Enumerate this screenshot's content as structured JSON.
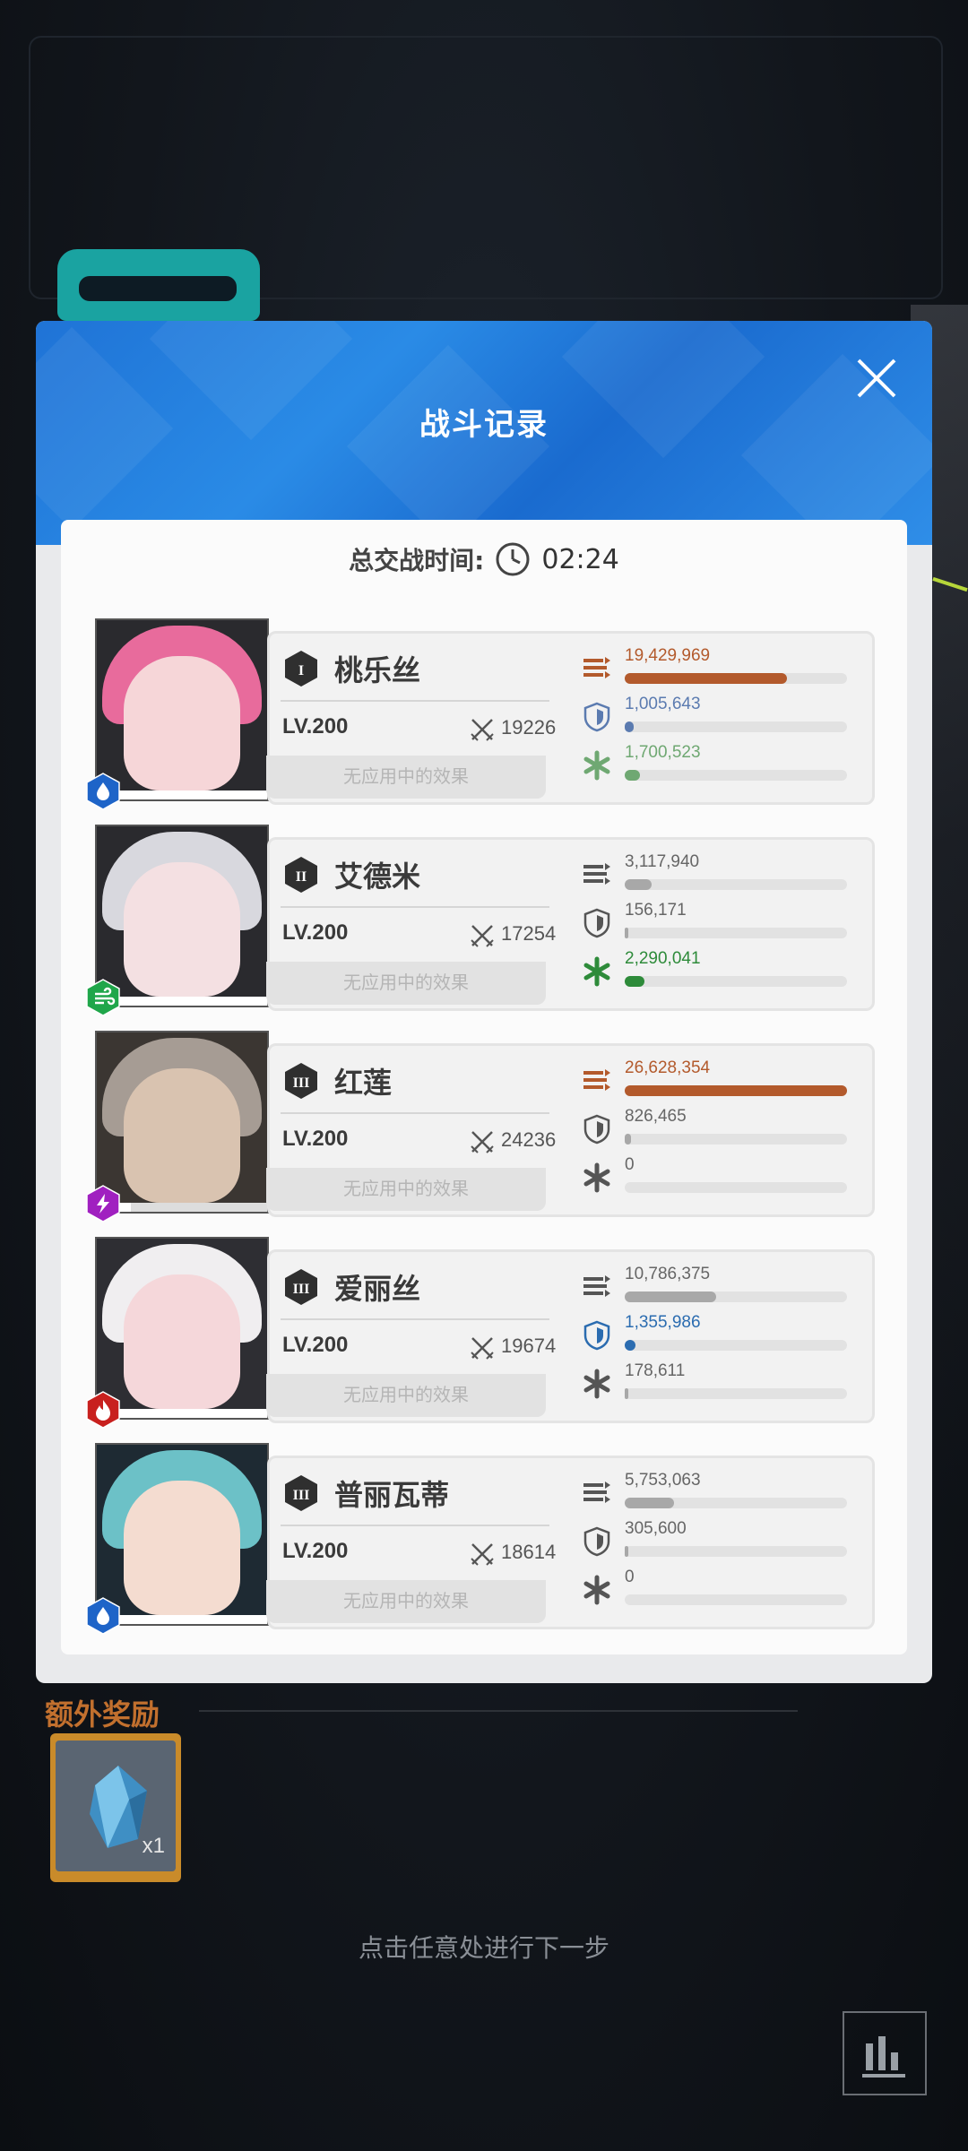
{
  "header": {
    "title": "战斗记录",
    "close_icon": "close-icon"
  },
  "battle": {
    "total_time_label": "总交战时间:",
    "total_time_value": "02:24"
  },
  "colors": {
    "panel_blue": "#1f73d6",
    "damage_bar": "#b35a2c",
    "defense_bar": "#2b6cb0",
    "heal_bar": "#2e8b3a",
    "grey_bar": "#a8a8a8",
    "bonus_title": "#c2702e"
  },
  "characters": [
    {
      "rank": "I",
      "name": "桃乐丝",
      "level": "LV.200",
      "power": "19226",
      "effect": "无应用中的效果",
      "element": "water",
      "damage": "19,429,969",
      "damage_ratio": 0.73,
      "damage_color": "#b35a2c",
      "defense": "1,005,643",
      "defense_ratio": 0.04,
      "defense_color": "#5b7bb0",
      "heal": "1,700,523",
      "heal_ratio": 0.07,
      "heal_color": "#6fa872"
    },
    {
      "rank": "II",
      "name": "艾德米",
      "level": "LV.200",
      "power": "17254",
      "effect": "无应用中的效果",
      "element": "wind",
      "damage": "3,117,940",
      "damage_ratio": 0.12,
      "damage_color": "#a8a8a8",
      "defense": "156,171",
      "defense_ratio": 0.01,
      "defense_color": "#a8a8a8",
      "heal": "2,290,041",
      "heal_ratio": 0.09,
      "heal_color": "#2e8b3a"
    },
    {
      "rank": "III",
      "name": "红莲",
      "level": "LV.200",
      "power": "24236",
      "effect": "无应用中的效果",
      "element": "electric",
      "damage": "26,628,354",
      "damage_ratio": 1.0,
      "damage_color": "#b35a2c",
      "defense": "826,465",
      "defense_ratio": 0.03,
      "defense_color": "#a8a8a8",
      "heal": "0",
      "heal_ratio": 0.0,
      "heal_color": "#a8a8a8"
    },
    {
      "rank": "III",
      "name": "爱丽丝",
      "level": "LV.200",
      "power": "19674",
      "effect": "无应用中的效果",
      "element": "fire",
      "damage": "10,786,375",
      "damage_ratio": 0.41,
      "damage_color": "#a8a8a8",
      "defense": "1,355,986",
      "defense_ratio": 0.05,
      "defense_color": "#2b6cb0",
      "heal": "178,611",
      "heal_ratio": 0.01,
      "heal_color": "#a8a8a8"
    },
    {
      "rank": "III",
      "name": "普丽瓦蒂",
      "level": "LV.200",
      "power": "18614",
      "effect": "无应用中的效果",
      "element": "water",
      "damage": "5,753,063",
      "damage_ratio": 0.22,
      "damage_color": "#a8a8a8",
      "defense": "305,600",
      "defense_ratio": 0.01,
      "defense_color": "#a8a8a8",
      "heal": "0",
      "heal_ratio": 0.0,
      "heal_color": "#a8a8a8"
    }
  ],
  "bonus": {
    "title": "额外奖励",
    "item_icon": "crystal-icon",
    "quantity": "x1"
  },
  "footer": {
    "hint": "点击任意处进行下一步",
    "stats_icon": "bar-chart-icon"
  }
}
